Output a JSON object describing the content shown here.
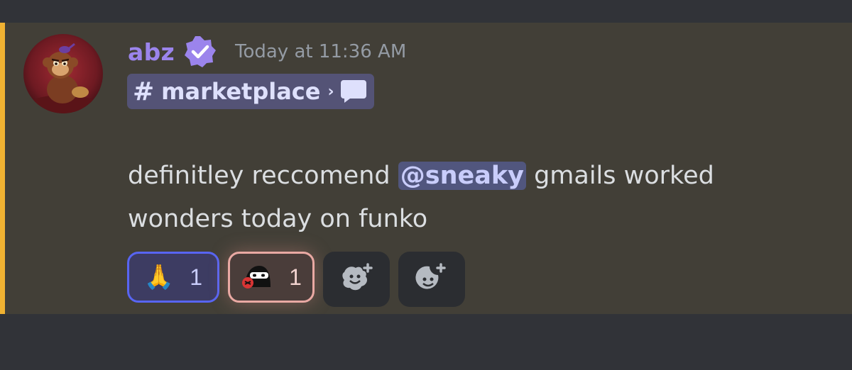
{
  "message": {
    "author": "abz",
    "timestamp": "Today at 11:36 AM",
    "channel": {
      "hash": "#",
      "name": "marketplace",
      "chevron": "›",
      "thread_icon": "speech-bubble-icon"
    },
    "content": {
      "before_mention": "definitley reccomend ",
      "mention": "@sneaky",
      "after_mention": " gmails worked wonders today on funko"
    },
    "reactions": [
      {
        "emoji": "🙏",
        "count": "1",
        "border": "#5865f2"
      },
      {
        "emoji": "ninja-emoji",
        "count": "1",
        "border": "#e9a9a3"
      }
    ],
    "add_buttons": [
      "add-super-reaction-icon",
      "add-reaction-icon"
    ]
  },
  "colors": {
    "mention_bar": "#f0b232",
    "username": "#9b84ec",
    "message_bg": "#423f37",
    "app_bg": "#313338"
  }
}
